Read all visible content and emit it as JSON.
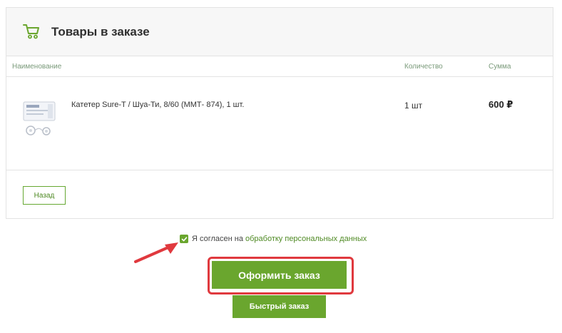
{
  "cart": {
    "title": "Товары в заказе",
    "icon": "shopping-cart-icon"
  },
  "table": {
    "headers": {
      "name": "Наименование",
      "quantity": "Количество",
      "sum": "Сумма"
    },
    "items": [
      {
        "name": "Катетер Sure-T / Шуа-Ти, 8/60 (ММТ- 874), 1 шт.",
        "quantity": "1 шт",
        "sum": "600 ₽"
      }
    ]
  },
  "buttons": {
    "back": "Назад",
    "order": "Оформить заказ",
    "quick_order": "Быстрый заказ"
  },
  "consent": {
    "text": "Я согласен на",
    "link": "обработку персональных данных",
    "checked": true
  },
  "colors": {
    "accent_green": "#6aa62e",
    "highlight_red": "#e0393e"
  }
}
